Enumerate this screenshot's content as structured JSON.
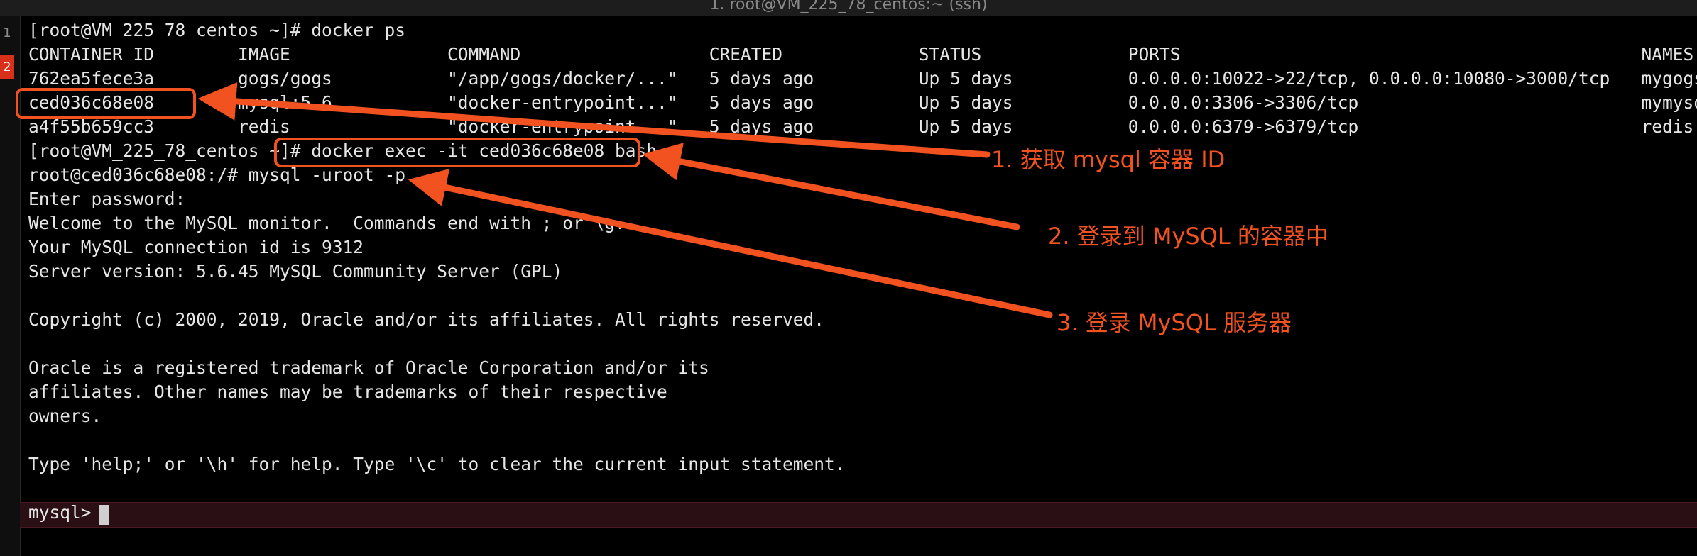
{
  "window": {
    "title": "1. root@VM_225_78_centos:~ (ssh)"
  },
  "gutter": [
    "1",
    "2"
  ],
  "terminal": {
    "lines": [
      "[root@VM_225_78_centos ~]# docker ps",
      "CONTAINER ID        IMAGE               COMMAND                  CREATED             STATUS              PORTS                                            NAMES",
      "762ea5fece3a        gogs/gogs           \"/app/gogs/docker/...\"   5 days ago          Up 5 days           0.0.0.0:10022->22/tcp, 0.0.0.0:10080->3000/tcp   mygogs",
      "ced036c68e08        mysql:5.6           \"docker-entrypoint...\"   5 days ago          Up 5 days           0.0.0.0:3306->3306/tcp                           mymysql",
      "a4f55b659cc3        redis               \"docker-entrypoint...\"   5 days ago          Up 5 days           0.0.0.0:6379->6379/tcp                           redis",
      "[root@VM_225_78_centos ~]# docker exec -it ced036c68e08 bash",
      "root@ced036c68e08:/# mysql -uroot -p",
      "Enter password:",
      "Welcome to the MySQL monitor.  Commands end with ; or \\g.",
      "Your MySQL connection id is 9312",
      "Server version: 5.6.45 MySQL Community Server (GPL)",
      "",
      "Copyright (c) 2000, 2019, Oracle and/or its affiliates. All rights reserved.",
      "",
      "Oracle is a registered trademark of Oracle Corporation and/or its",
      "affiliates. Other names may be trademarks of their respective",
      "owners.",
      "",
      "Type 'help;' or '\\h' for help. Type '\\c' to clear the current input statement.",
      "",
      "mysql> "
    ]
  },
  "annotations": {
    "note1": "1. 获取 mysql 容器 ID",
    "note2": "2. 登录到 MySQL 的容器中",
    "note3": "3. 登录 MySQL 服务器"
  },
  "colors": {
    "background": "#000000",
    "text": "#e6e6e6",
    "annotation": "#f2521f",
    "prompt_line": "#2a0f15"
  }
}
